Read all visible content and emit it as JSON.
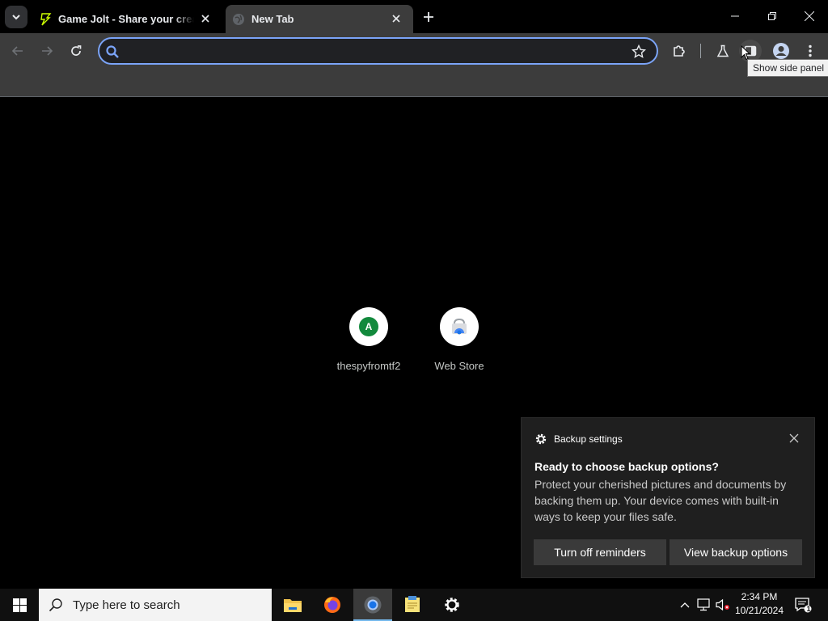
{
  "browser": {
    "tabs": [
      {
        "title": "Game Jolt - Share your creations",
        "favicon": "game-jolt-icon"
      },
      {
        "title": "New Tab",
        "favicon": "globe-icon"
      }
    ],
    "omnibox": {
      "value": "",
      "placeholder": ""
    },
    "tooltip": "Show side panel"
  },
  "new_tab": {
    "shortcuts": [
      {
        "label": "thespyfromtf2",
        "letter": "A",
        "color": "#12893c"
      },
      {
        "label": "Web Store",
        "icon": "web-store-icon"
      }
    ]
  },
  "toast": {
    "app": "Backup settings",
    "heading": "Ready to choose backup options?",
    "body": "Protect your cherished pictures and documents by backing them up. Your device comes with built-in ways to keep your files safe.",
    "buttons": {
      "turn_off": "Turn off reminders",
      "view": "View backup options"
    }
  },
  "taskbar": {
    "search_placeholder": "Type here to search",
    "time": "2:34 PM",
    "date": "10/21/2024",
    "notification_count": "1"
  }
}
